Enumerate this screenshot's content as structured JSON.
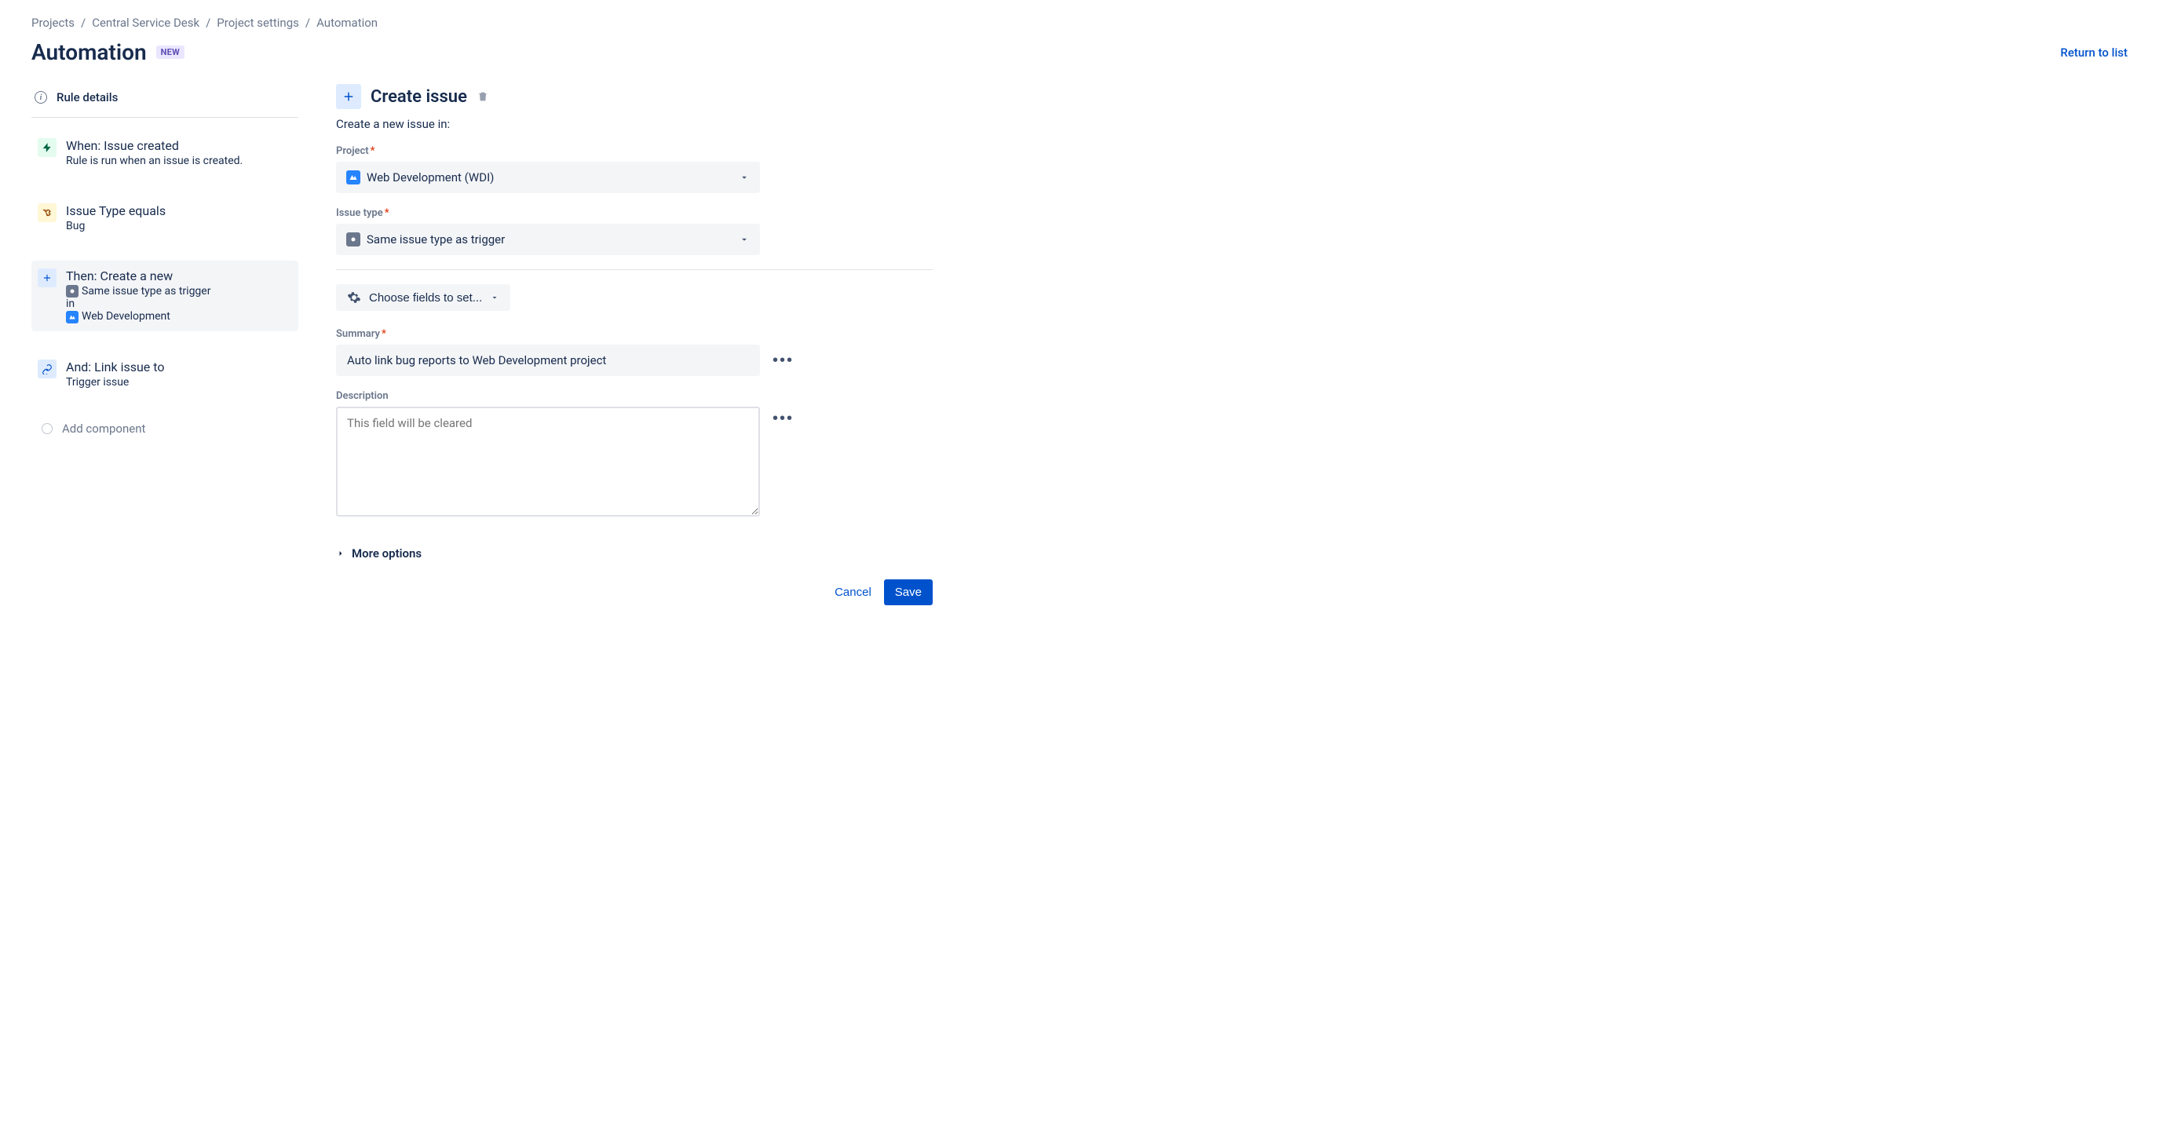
{
  "breadcrumb": {
    "items": [
      "Projects",
      "Central Service Desk",
      "Project settings",
      "Automation"
    ]
  },
  "header": {
    "title": "Automation",
    "badge": "NEW",
    "return_link": "Return to list"
  },
  "sidebar": {
    "rule_details_label": "Rule details",
    "chain": [
      {
        "title": "When: Issue created",
        "sub": "Rule is run when an issue is created."
      },
      {
        "title": "Issue Type equals",
        "sub": "Bug"
      },
      {
        "title": "Then: Create a new",
        "sub_a": "Same issue type as trigger",
        "sub_b": "in",
        "sub_c": "Web Development"
      },
      {
        "title": "And: Link issue to",
        "sub": "Trigger issue"
      }
    ],
    "add_component": "Add component"
  },
  "form": {
    "title": "Create issue",
    "subtitle": "Create a new issue in:",
    "project": {
      "label": "Project",
      "value": "Web Development (WDI)"
    },
    "issue_type": {
      "label": "Issue type",
      "value": "Same issue type as trigger"
    },
    "choose_fields": "Choose fields to set...",
    "summary": {
      "label": "Summary",
      "value": "Auto link bug reports to Web Development project"
    },
    "description": {
      "label": "Description",
      "placeholder": "This field will be cleared"
    },
    "more_options": "More options",
    "cancel": "Cancel",
    "save": "Save"
  }
}
